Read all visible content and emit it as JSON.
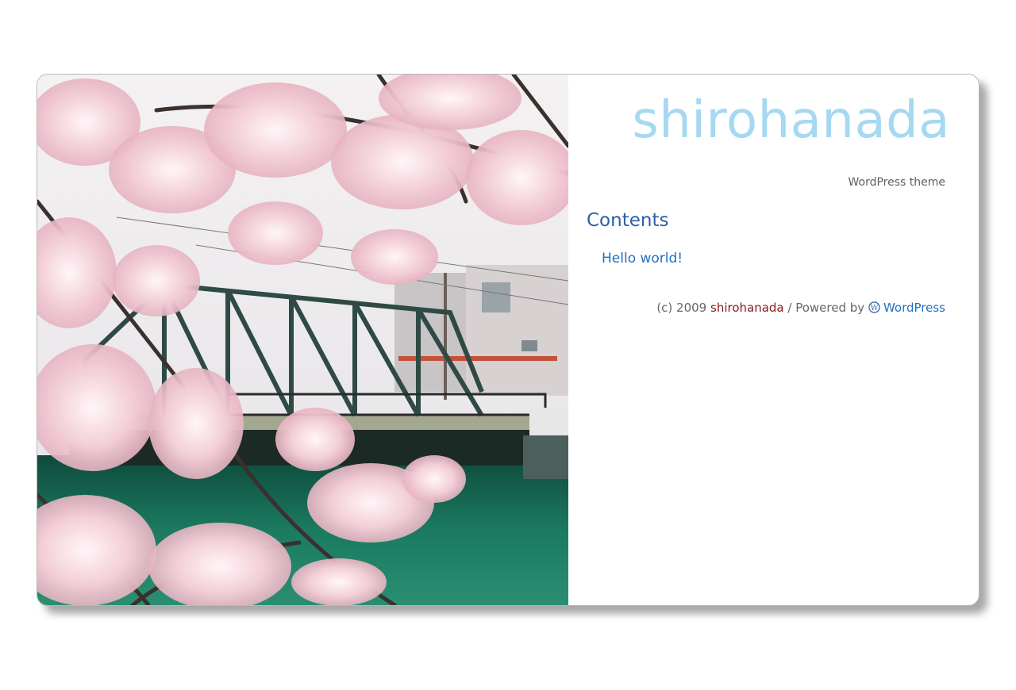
{
  "site": {
    "title": "shirohanada",
    "tagline": "WordPress theme"
  },
  "content": {
    "heading": "Contents",
    "posts": [
      {
        "title": "Hello world!"
      }
    ]
  },
  "footer": {
    "copyright": "(c) 2009",
    "site_name": "shirohanada",
    "separator": "/ Powered by",
    "powered_link": "WordPress"
  },
  "colors": {
    "title": "#a6d8f1",
    "heading": "#2f5fa6",
    "link": "#1f6fc4",
    "footer_site_link": "#8b1a1a"
  },
  "header_image": {
    "description_icon": "cherry-blossom-photo"
  }
}
